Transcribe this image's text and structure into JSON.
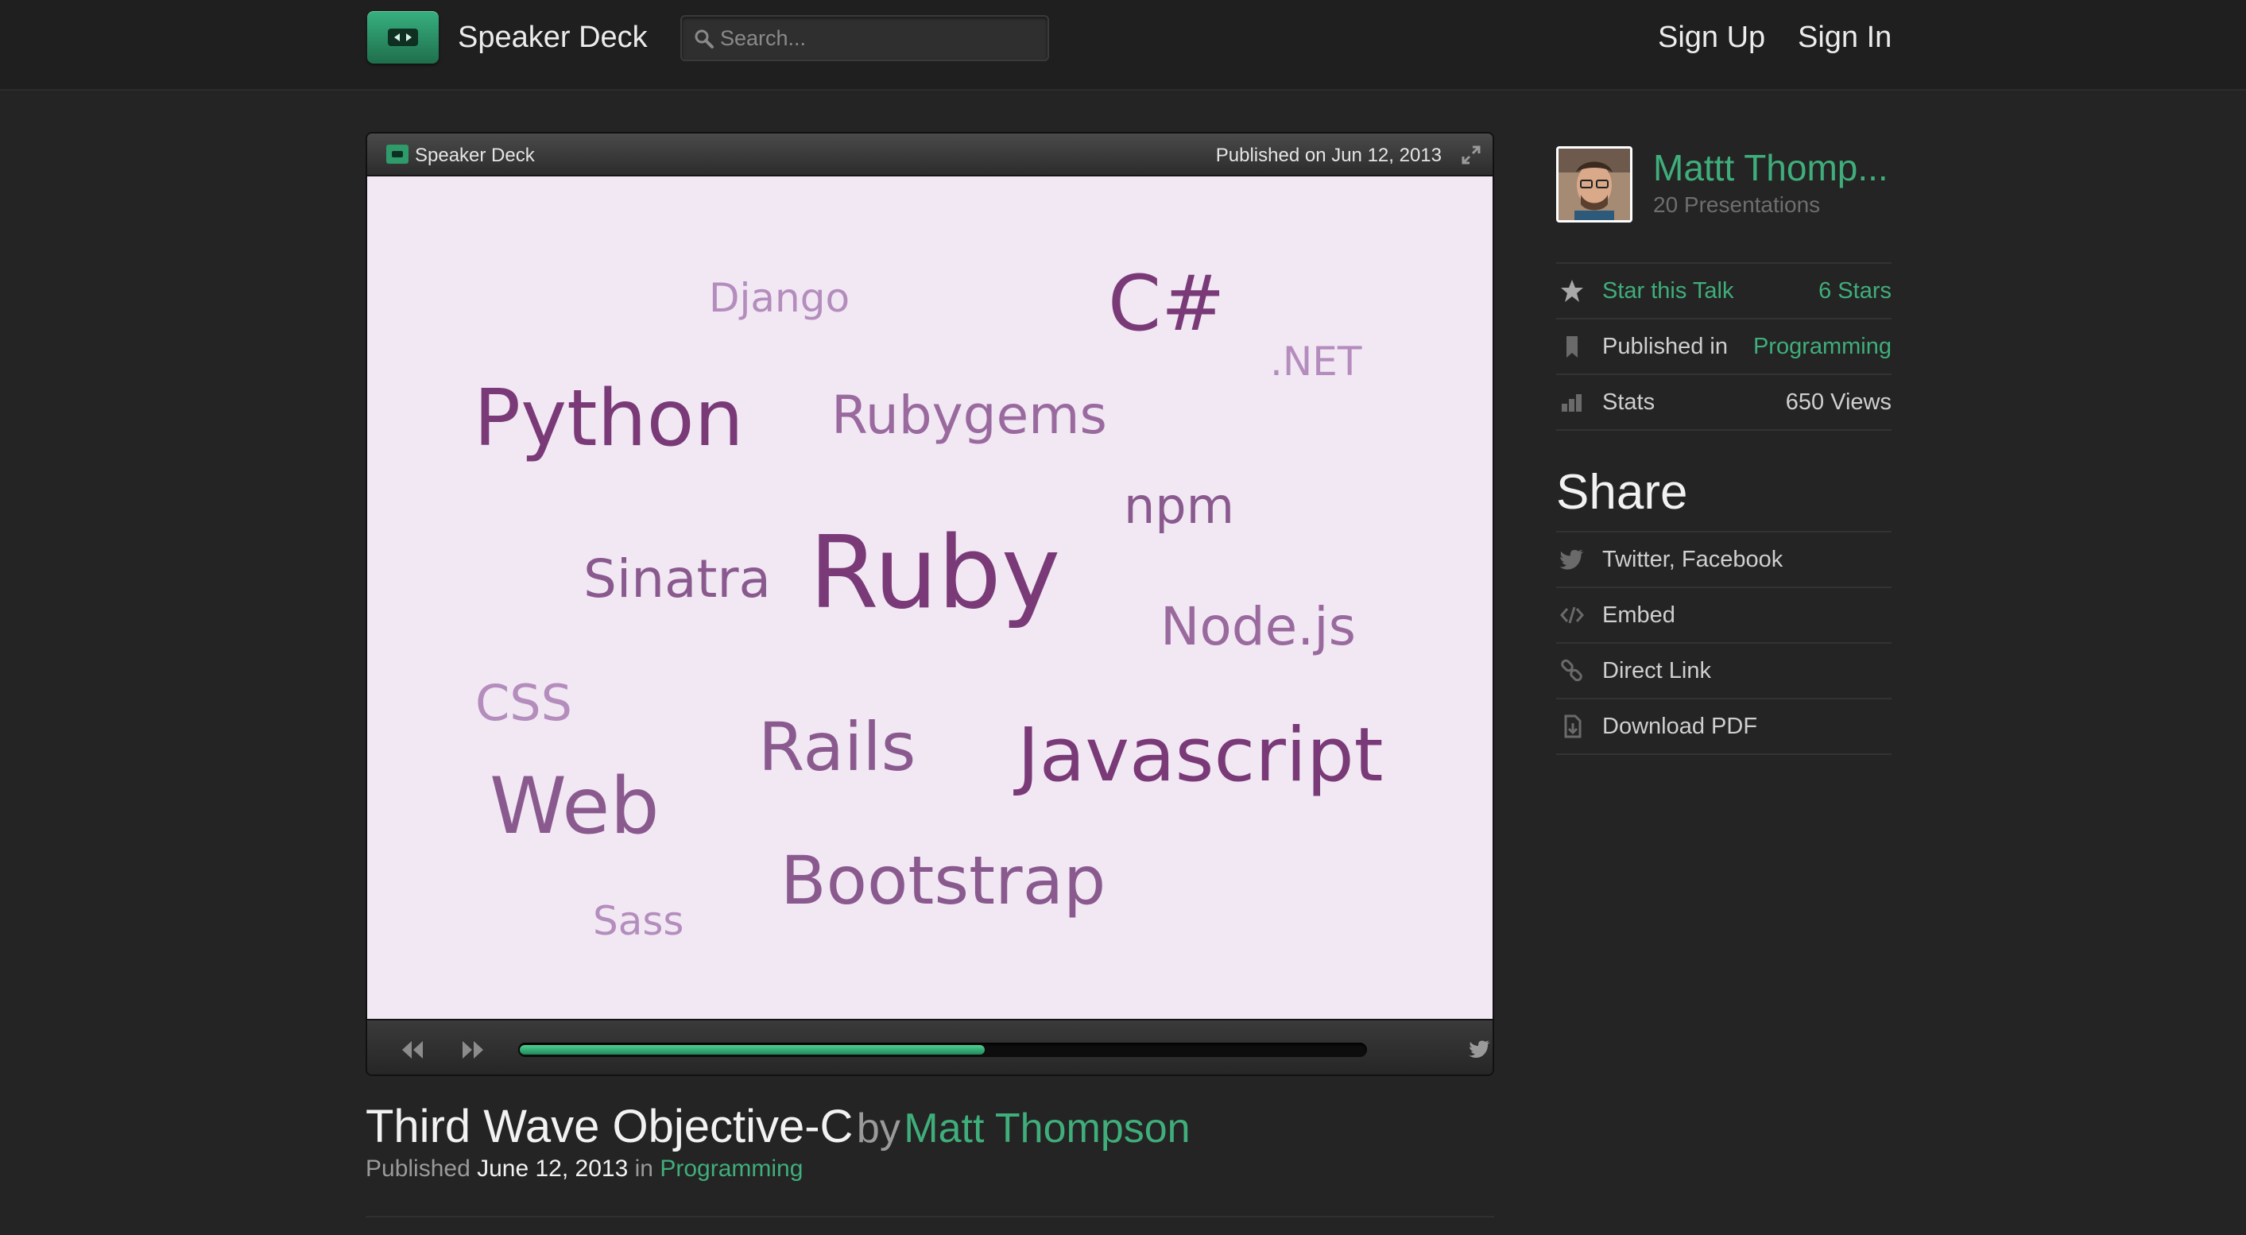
{
  "header": {
    "brand": "Speaker Deck",
    "search_placeholder": "Search...",
    "sign_up": "Sign Up",
    "sign_in": "Sign In"
  },
  "viewer": {
    "brand": "Speaker Deck",
    "published": "Published on Jun 12, 2013",
    "share_label": "share",
    "progress": 0.55,
    "slide_words": [
      {
        "text": "Django",
        "color": "#b48dbd"
      },
      {
        "text": "C#",
        "color": "#7a3a77"
      },
      {
        "text": ".NET",
        "color": "#b48dbd"
      },
      {
        "text": "Python",
        "color": "#7a3a77"
      },
      {
        "text": "Rubygems",
        "color": "#9a6a9f"
      },
      {
        "text": "npm",
        "color": "#8a5a8f"
      },
      {
        "text": "Sinatra",
        "color": "#8a5a8f"
      },
      {
        "text": "Ruby",
        "color": "#7a3a77"
      },
      {
        "text": "Node.js",
        "color": "#9a6a9f"
      },
      {
        "text": "CSS",
        "color": "#b48dbd"
      },
      {
        "text": "Rails",
        "color": "#8a5a8f"
      },
      {
        "text": "Javascript",
        "color": "#7a3a77"
      },
      {
        "text": "Web",
        "color": "#8a5a8f"
      },
      {
        "text": "Bootstrap",
        "color": "#8a5a8f"
      },
      {
        "text": "Sass",
        "color": "#b48dbd"
      }
    ]
  },
  "talk": {
    "title": "Third Wave Objective-C",
    "by": "by",
    "author": "Matt Thompson",
    "published_label": "Published",
    "date": "June 12, 2013",
    "in_label": "in",
    "category": "Programming"
  },
  "sidebar": {
    "author_name": "Mattt Thomp...",
    "presentations": "20 Presentations",
    "star_label": "Star this Talk",
    "stars": "6 Stars",
    "published_in_label": "Published in",
    "category": "Programming",
    "stats_label": "Stats",
    "views": "650 Views",
    "share_heading": "Share",
    "share_items": [
      "Twitter, Facebook",
      "Embed",
      "Direct Link",
      "Download PDF"
    ]
  },
  "colors": {
    "accent": "#3fae7b",
    "background": "#242424",
    "slide_background": "#f1e8f4"
  }
}
